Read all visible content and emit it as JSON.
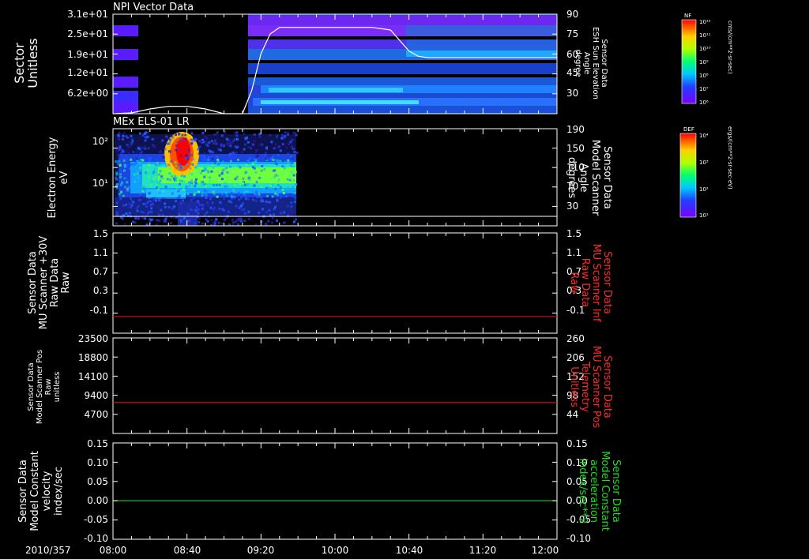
{
  "colors": {
    "background": "#000000",
    "frame": "#ffffff",
    "red_line": "#cc1111",
    "green_line": "#22cc22",
    "red_text": "#ff2a2a",
    "green_text": "#22dd22"
  },
  "x_axis": {
    "date_label": "2010/357",
    "ticks": [
      "08:00",
      "08:40",
      "09:20",
      "10:00",
      "10:40",
      "11:20",
      "12:00"
    ]
  },
  "chart_data": [
    {
      "type": "heatmap",
      "title": "NPI Vector Data",
      "ylabel": [
        "Sector",
        "Unitless"
      ],
      "yticks_left": [
        "3.1e+01",
        "2.5e+01",
        "1.9e+01",
        "1.2e+01",
        "6.2e+00"
      ],
      "yticks_right": [
        "90",
        "75",
        "60",
        "45",
        "30"
      ],
      "ylabel_right": [
        "Sensor Data",
        "ESH Sun Elevation",
        "Angle",
        "degree"
      ],
      "colorbar": {
        "label": "NF",
        "units": "cnts/(cm**2-sr-sec)",
        "ticks": [
          "10^12",
          "10^11",
          "10^10",
          "10^9",
          "10^8",
          "10^7",
          "10^6"
        ]
      },
      "overlay_line": {
        "name": "ESH Sun Elevation Angle",
        "x": [
          "08:00",
          "08:10",
          "08:20",
          "08:30",
          "08:40",
          "08:50",
          "09:00",
          "09:10",
          "09:15",
          "09:20",
          "09:25",
          "09:30",
          "09:35",
          "09:40",
          "10:00",
          "10:20",
          "10:30",
          "10:35",
          "10:40",
          "10:45",
          "10:50",
          "11:00",
          "11:20",
          "11:40",
          "12:00"
        ],
        "y": [
          12,
          15,
          18,
          20,
          20,
          18,
          14,
          10,
          32,
          60,
          75,
          80,
          80,
          80,
          80,
          80,
          78,
          70,
          62,
          58,
          57,
          57,
          57,
          57,
          57
        ]
      }
    },
    {
      "type": "heatmap",
      "title": "MEx ELS-01 LR",
      "ylabel": [
        "Electron Energy",
        "eV"
      ],
      "yticks_left": [
        "10^2",
        "10^1"
      ],
      "yticks_right": [
        "190",
        "150",
        "110",
        "70",
        "30"
      ],
      "ylabel_right": [
        "Sensor Data",
        "Model Scanner",
        "Angle",
        "degrees"
      ],
      "colorbar": {
        "label": "DEF",
        "units": "ergs/(cm**2-sr-sec-eV)",
        "ticks": [
          "10^4",
          "10^3",
          "10^2",
          "10^1"
        ]
      }
    },
    {
      "type": "line",
      "ylabel": [
        "Sensor Data",
        "MU Scanner +30V",
        "Raw Data",
        "Raw"
      ],
      "yticks_left": [
        "1.5",
        "1.1",
        "0.7",
        "0.3",
        "-0.1"
      ],
      "yticks_right": [
        "1.5",
        "1.1",
        "0.7",
        "0.3",
        "-0.1"
      ],
      "ylabel_right": [
        "Sensor Data",
        "MU Scanner Inf",
        "Raw Data",
        "Raw"
      ],
      "ylim": [
        -0.3,
        1.5
      ],
      "series": [
        {
          "name": "Raw Data",
          "y": 0.0,
          "color": "#cc1111"
        }
      ]
    },
    {
      "type": "line",
      "ylabel": [
        "Sensor Data",
        "Model Scanner Pos",
        "Raw",
        "unitless"
      ],
      "yticks_left": [
        "23500",
        "18800",
        "14100",
        "9400",
        "4700"
      ],
      "yticks_right": [
        "260",
        "206",
        "152",
        "98",
        "44"
      ],
      "ylabel_right": [
        "Sensor Data",
        "MU Scanner Pos",
        "Telemetry",
        "Unitless"
      ],
      "ylim": [
        0,
        23500
      ],
      "series": [
        {
          "name": "Telemetry",
          "y": 7600,
          "color": "#cc1111"
        }
      ]
    },
    {
      "type": "line",
      "ylabel": [
        "Sensor Data",
        "Model Constant",
        "velocity",
        "index/sec"
      ],
      "yticks_left": [
        "0.15",
        "0.10",
        "0.05",
        "0.00",
        "-0.05",
        "-0.10"
      ],
      "yticks_right": [
        "0.15",
        "0.10",
        "0.05",
        "0.00",
        "-0.05",
        "-0.10"
      ],
      "ylabel_right": [
        "Sensor Data",
        "Model Constant",
        "acceleration",
        "index/sec**2"
      ],
      "ylim": [
        -0.1,
        0.15
      ],
      "series": [
        {
          "name": "acceleration",
          "y": 0.0,
          "color": "#22cc22"
        }
      ]
    }
  ]
}
